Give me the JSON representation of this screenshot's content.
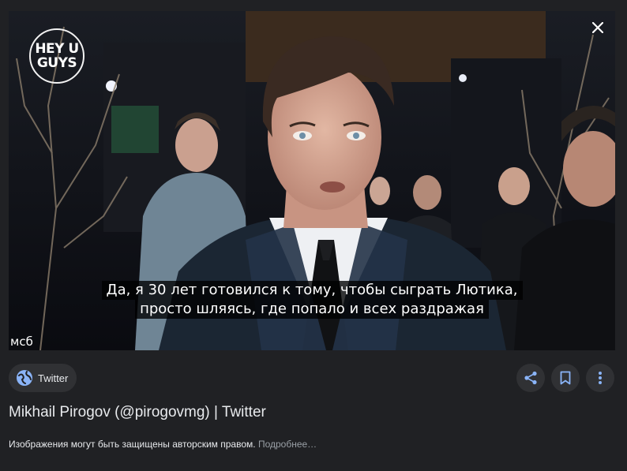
{
  "image": {
    "logo_lines": [
      "HEY U",
      "GUYS"
    ],
    "subtitle_lines": [
      "Да, я 30 лет готовился к тому, чтобы сыграть Лютика,",
      "просто шляясь, где попало и всех раздражая"
    ],
    "watermark": "мсб"
  },
  "source": {
    "name": "Twitter",
    "icon": "globe-icon"
  },
  "actions": {
    "share_icon": "share-icon",
    "save_icon": "bookmark-icon",
    "more_icon": "more-vert-icon"
  },
  "title": "Mikhail Pirogov (@pirogovmg) | Twitter",
  "copyright": {
    "text": "Изображения могут быть защищены авторским правом.",
    "more_link": "Подробнее…"
  },
  "colors": {
    "background": "#202124",
    "chip": "#303134",
    "icon_blue": "#8ab4f8"
  }
}
